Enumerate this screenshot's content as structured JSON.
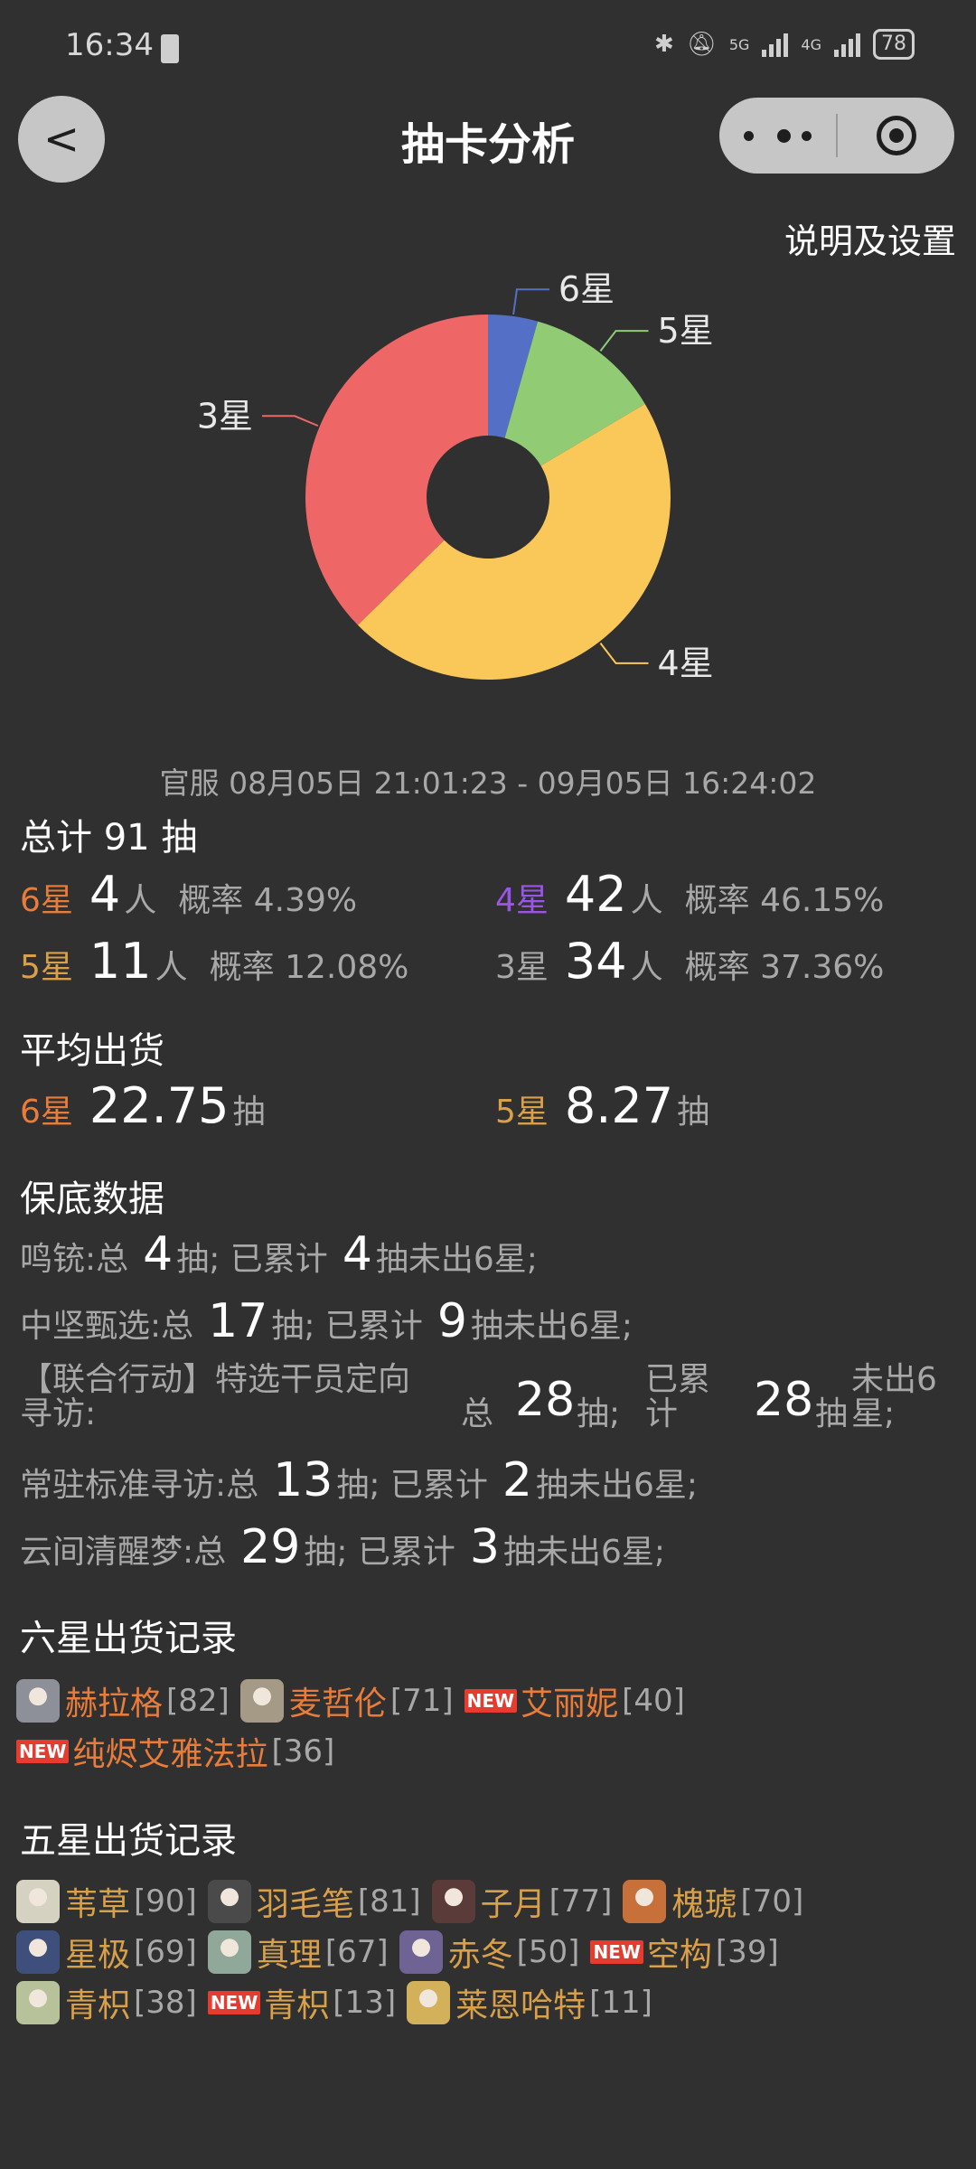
{
  "status_bar": {
    "time": "16:34",
    "net1": "5G",
    "net2": "4G",
    "battery": "78"
  },
  "nav": {
    "back_label": "<",
    "title": "抽卡分析"
  },
  "settings_label": "说明及设置",
  "chart_data": {
    "type": "pie",
    "donut": true,
    "slices": [
      {
        "label": "6星",
        "value": 4,
        "color": "#5470c6"
      },
      {
        "label": "5星",
        "value": 11,
        "color": "#91cc75"
      },
      {
        "label": "4星",
        "value": 42,
        "color": "#fac858"
      },
      {
        "label": "3星",
        "value": 34,
        "color": "#ee6666"
      }
    ]
  },
  "range_text": "官服  08月05日 21:01:23 - 09月05日 16:24:02",
  "summary": {
    "total_label": "总计 91 抽",
    "rows": [
      {
        "star": "6星",
        "count": "4",
        "unit": "人",
        "rate": "概率 4.39%"
      },
      {
        "star": "4星",
        "count": "42",
        "unit": "人",
        "rate": "概率 46.15%"
      },
      {
        "star": "5星",
        "count": "11",
        "unit": "人",
        "rate": "概率 12.08%"
      },
      {
        "star": "3星",
        "count": "34",
        "unit": "人",
        "rate": "概率 37.36%"
      }
    ]
  },
  "average": {
    "heading": "平均出货",
    "six": {
      "star": "6星",
      "value": "22.75",
      "unit": "抽"
    },
    "five": {
      "star": "5星",
      "value": "8.27",
      "unit": "抽"
    }
  },
  "pity": {
    "heading": "保底数据",
    "rows": [
      {
        "name": "鸣铳:总",
        "total": "4",
        "mid": "抽; 已累计",
        "acc": "4",
        "tail": "抽未出6星;"
      },
      {
        "name": "中坚甄选:总",
        "total": "17",
        "mid": "抽; 已累计",
        "acc": "9",
        "tail": "抽未出6星;"
      },
      {
        "name": "常驻标准寻访:总",
        "total": "13",
        "mid": "抽; 已累计",
        "acc": "2",
        "tail": "抽未出6星;"
      },
      {
        "name": "云间清醒梦:总",
        "total": "29",
        "mid": "抽; 已累计",
        "acc": "3",
        "tail": "抽未出6星;"
      }
    ],
    "special": {
      "name_line1": "【联合行动】特选干员定向",
      "name_line2": "寻访:",
      "zong": "总",
      "total": "28",
      "chou": "抽;",
      "yilei": "已累",
      "ji": "计",
      "acc": "28",
      "chou2": "抽",
      "weichu": "未出6",
      "xing": "星;"
    }
  },
  "six_records": {
    "heading": "六星出货记录",
    "items": [
      {
        "name": "赫拉格",
        "count": "[82]",
        "is_new": false,
        "new_label": "",
        "avatar_color": "#8d8f99"
      },
      {
        "name": "麦哲伦",
        "count": "[71]",
        "is_new": false,
        "new_label": "",
        "avatar_color": "#a59a86"
      },
      {
        "name": "艾丽妮",
        "count": "[40]",
        "is_new": true,
        "new_label": "NEW",
        "avatar_color": "#b8b8b8"
      },
      {
        "name": "纯烬艾雅法拉",
        "count": "[36]",
        "is_new": true,
        "new_label": "NEW",
        "avatar_color": "#c9a0a0"
      }
    ]
  },
  "five_records": {
    "heading": "五星出货记录",
    "items": [
      {
        "name": "苇草",
        "count": "[90]",
        "is_new": false,
        "new_label": "",
        "avatar_color": "#d6d2c2"
      },
      {
        "name": "羽毛笔",
        "count": "[81]",
        "is_new": false,
        "new_label": "",
        "avatar_color": "#4a4a4a"
      },
      {
        "name": "子月",
        "count": "[77]",
        "is_new": false,
        "new_label": "",
        "avatar_color": "#5b3a3a"
      },
      {
        "name": "槐琥",
        "count": "[70]",
        "is_new": false,
        "new_label": "",
        "avatar_color": "#c7703a"
      },
      {
        "name": "星极",
        "count": "[69]",
        "is_new": false,
        "new_label": "",
        "avatar_color": "#3d4f7a"
      },
      {
        "name": "真理",
        "count": "[67]",
        "is_new": false,
        "new_label": "",
        "avatar_color": "#8fa89a"
      },
      {
        "name": "赤冬",
        "count": "[50]",
        "is_new": false,
        "new_label": "",
        "avatar_color": "#6f6394"
      },
      {
        "name": "空构",
        "count": "[39]",
        "is_new": true,
        "new_label": "NEW",
        "avatar_color": "#9bb0d0"
      },
      {
        "name": "青枳",
        "count": "[38]",
        "is_new": false,
        "new_label": "",
        "avatar_color": "#b8c29a"
      },
      {
        "name": "青枳",
        "count": "[13]",
        "is_new": true,
        "new_label": "NEW",
        "avatar_color": "#b8c29a"
      },
      {
        "name": "莱恩哈特",
        "count": "[11]",
        "is_new": false,
        "new_label": "",
        "avatar_color": "#d3b15a"
      }
    ]
  }
}
